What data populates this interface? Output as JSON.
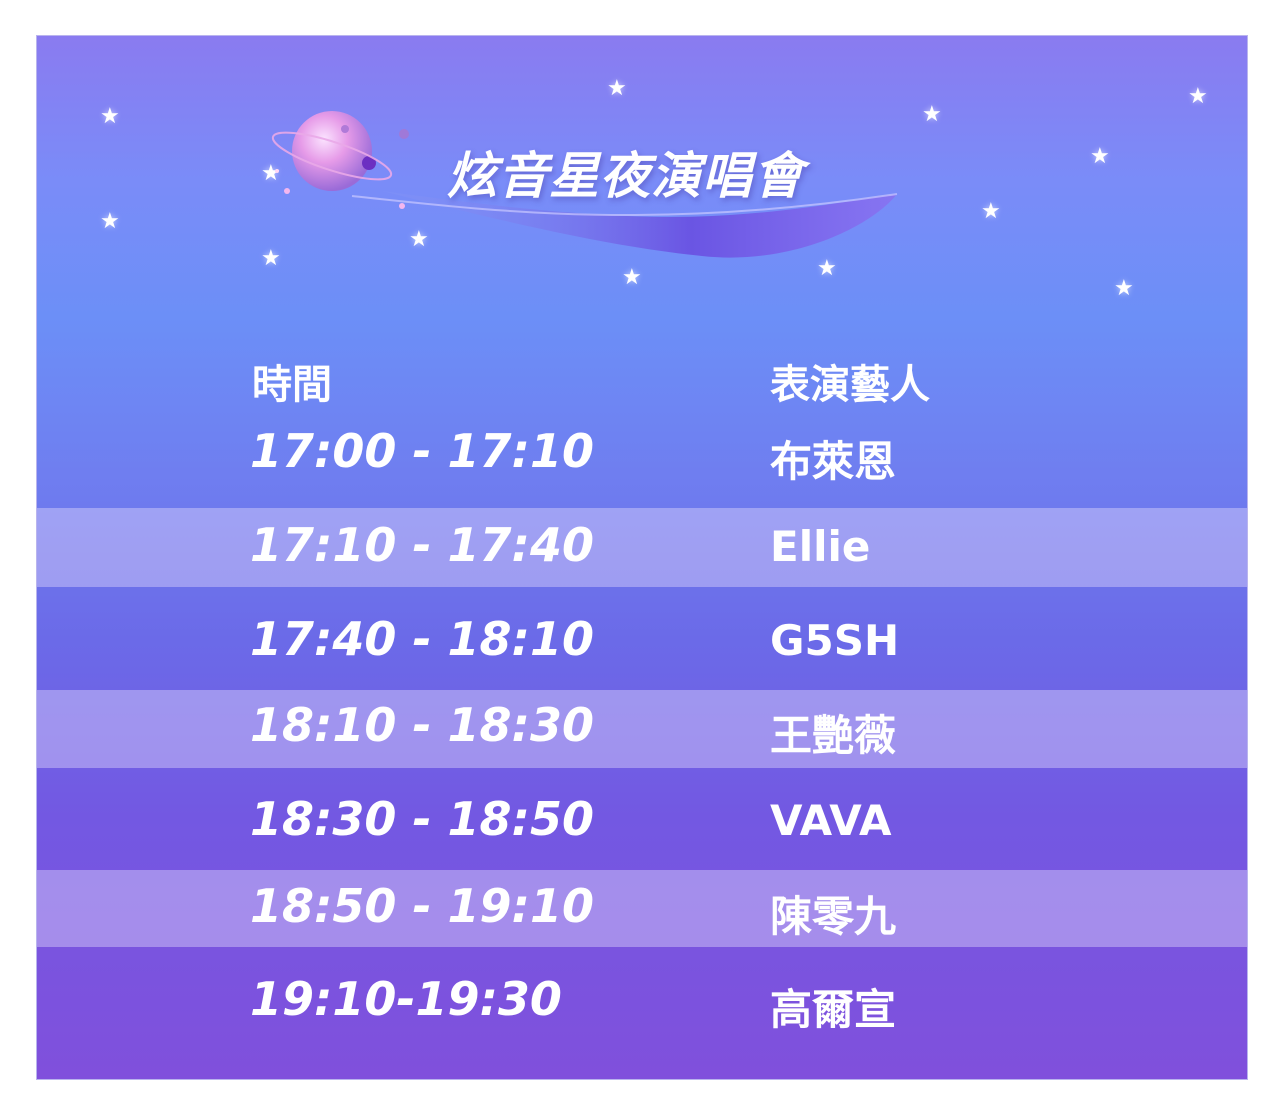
{
  "title": "炫音星夜演唱會",
  "header": {
    "time_label": "時間",
    "artist_label": "表演藝人"
  },
  "schedule": [
    {
      "time": "17:00 - 17:10",
      "artist": "布萊恩"
    },
    {
      "time": "17:10 - 17:40",
      "artist": "Ellie"
    },
    {
      "time": "17:40 - 18:10",
      "artist": "G5SH"
    },
    {
      "time": "18:10 - 18:30",
      "artist": "王艷薇"
    },
    {
      "time": "18:30 - 18:50",
      "artist": "VAVA"
    },
    {
      "time": "18:50 - 19:10",
      "artist": "陳零九"
    },
    {
      "time": "19:10-19:30",
      "artist": "高爾宣"
    }
  ],
  "decor": {
    "planet_icon": "planet-icon",
    "star_icon": "star-icon"
  }
}
